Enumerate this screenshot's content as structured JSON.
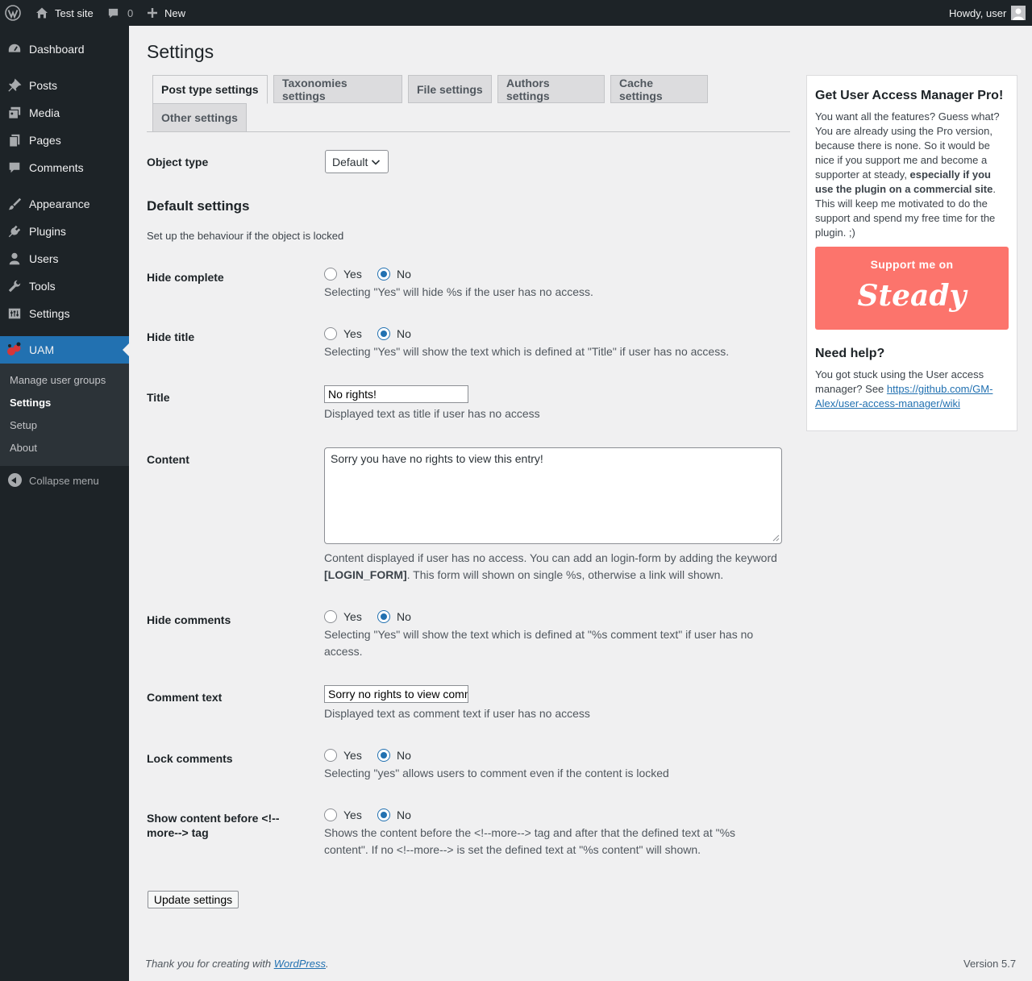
{
  "admin_bar": {
    "site_name": "Test site",
    "comments_count": "0",
    "new_label": "New",
    "howdy": "Howdy, user"
  },
  "menu": {
    "items": [
      {
        "label": "Dashboard",
        "icon": "dashboard-icon"
      },
      {
        "label": "Posts",
        "icon": "pin-icon"
      },
      {
        "label": "Media",
        "icon": "media-icon"
      },
      {
        "label": "Pages",
        "icon": "page-icon"
      },
      {
        "label": "Comments",
        "icon": "comment-icon"
      },
      {
        "label": "Appearance",
        "icon": "paintbrush-icon"
      },
      {
        "label": "Plugins",
        "icon": "plug-icon"
      },
      {
        "label": "Users",
        "icon": "user-icon"
      },
      {
        "label": "Tools",
        "icon": "wrench-icon"
      },
      {
        "label": "Settings",
        "icon": "settings-icon"
      },
      {
        "label": "UAM",
        "icon": "uam-icon"
      }
    ],
    "submenu": [
      "Manage user groups",
      "Settings",
      "Setup",
      "About"
    ],
    "collapse_label": "Collapse menu",
    "current_color": "#2271b1"
  },
  "page": {
    "title": "Settings",
    "tabs": [
      "Post type settings",
      "Taxonomies settings",
      "File settings",
      "Authors settings",
      "Cache settings",
      "Other settings"
    ],
    "object_type_label": "Object type",
    "object_type_value": "Default",
    "section_title": "Default settings",
    "section_desc": "Set up the behaviour if the object is locked",
    "yes": "Yes",
    "no": "No",
    "hide_complete": {
      "label": "Hide complete",
      "desc": "Selecting \"Yes\" will hide %s if the user has no access.",
      "value": "No"
    },
    "hide_title": {
      "label": "Hide title",
      "desc": "Selecting \"Yes\" will show the text which is defined at \"Title\" if user has no access.",
      "value": "No"
    },
    "title_field": {
      "label": "Title",
      "value": "No rights!",
      "desc": "Displayed text as title if user has no access"
    },
    "content_field": {
      "label": "Content",
      "value": "Sorry you have no rights to view this entry!",
      "desc_1": "Content displayed if user has no access. You can add an login-form by adding the keyword",
      "desc_keyword": "[LOGIN_FORM]",
      "desc_2": ". This form will shown on single %s, otherwise a link will shown."
    },
    "hide_comments": {
      "label": "Hide comments",
      "desc_1": "Selecting \"Yes\" will show the text which is defined at \"%s comment text\" if user has no",
      "desc_2": "access.",
      "value": "No"
    },
    "comment_text": {
      "label": "Comment text",
      "value": "Sorry no rights to view comments!",
      "desc": "Displayed text as comment text if user has no access"
    },
    "lock_comments": {
      "label": "Lock comments",
      "desc": "Selecting \"yes\" allows users to comment even if the content is locked",
      "value": "No"
    },
    "show_content": {
      "label_1": "Show content before <!--",
      "label_2": "more--> tag",
      "desc_1": "Shows the content before the <!--more--> tag and after that the defined text at \"%s",
      "desc_2": "content\". If no <!--more--> is set the defined text at \"%s content\" will shown.",
      "value": "No"
    },
    "update_button": "Update settings"
  },
  "sidebar": {
    "pro_title": "Get User Access Manager Pro!",
    "pro_lines": [
      "You want all the features? Guess what?",
      "You are already using the Pro version,",
      "because there is none. So it would be",
      "nice if you support me and become a"
    ],
    "pro_line5_plain": "supporter at steady, ",
    "pro_line5_bold": "especially if you",
    "pro_line6_bold": "use the plugin on a commercial site",
    "pro_line6_plain": ".",
    "pro_lines_end": [
      "This will keep me motivated to do the",
      "support and spend my free time for the",
      "plugin. ;)"
    ],
    "steady_top": "Support me on",
    "steady_brand": "Steady",
    "steady_color": "#fc746c",
    "help_title": "Need help?",
    "help_line1": "You got stuck using the User access",
    "help_line2": "manager? See ",
    "help_link_1": "https://github.com/GM-",
    "help_link_2": "Alex/user-access-manager/wiki"
  },
  "footer": {
    "thanks": "Thank you for creating with ",
    "wp_link": "WordPress",
    "period": ".",
    "version": "Version 5.7"
  }
}
